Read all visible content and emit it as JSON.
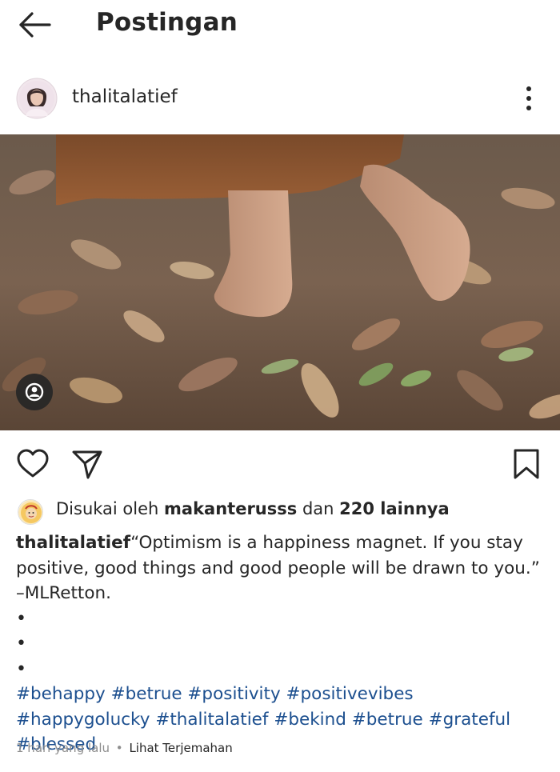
{
  "header": {
    "title": "Postingan",
    "back_icon": "arrow-left-icon"
  },
  "post": {
    "username": "thalitalatief",
    "more_icon": "more-vertical-icon",
    "photo_alt": "barefoot-on-leaves-photo",
    "tag_icon": "user-tag-icon"
  },
  "actions": {
    "like_icon": "heart-icon",
    "share_icon": "send-icon",
    "save_icon": "bookmark-icon"
  },
  "likes": {
    "prefix": "Disukai oleh",
    "liker": "makanterusss",
    "middle": "dan",
    "others": "220 lainnya"
  },
  "caption": {
    "username": "thalitalatief",
    "text": "“Optimism is a happiness magnet. If you stay positive, good things and good people will be drawn to you.” –MLRetton.",
    "hashtags": [
      "#behappy",
      "#betrue",
      "#positivity",
      "#positivevibes",
      "#happygolucky",
      "#thalitalatief",
      "#bekind",
      "#betrue",
      "#grateful",
      "#blessed"
    ]
  },
  "meta": {
    "time": "1 hari yang lalu",
    "separator": "•",
    "translate": "Lihat Terjemahan"
  },
  "colors": {
    "text": "#262626",
    "hashtag": "#1c4f8f",
    "meta": "#8e8e8e"
  }
}
